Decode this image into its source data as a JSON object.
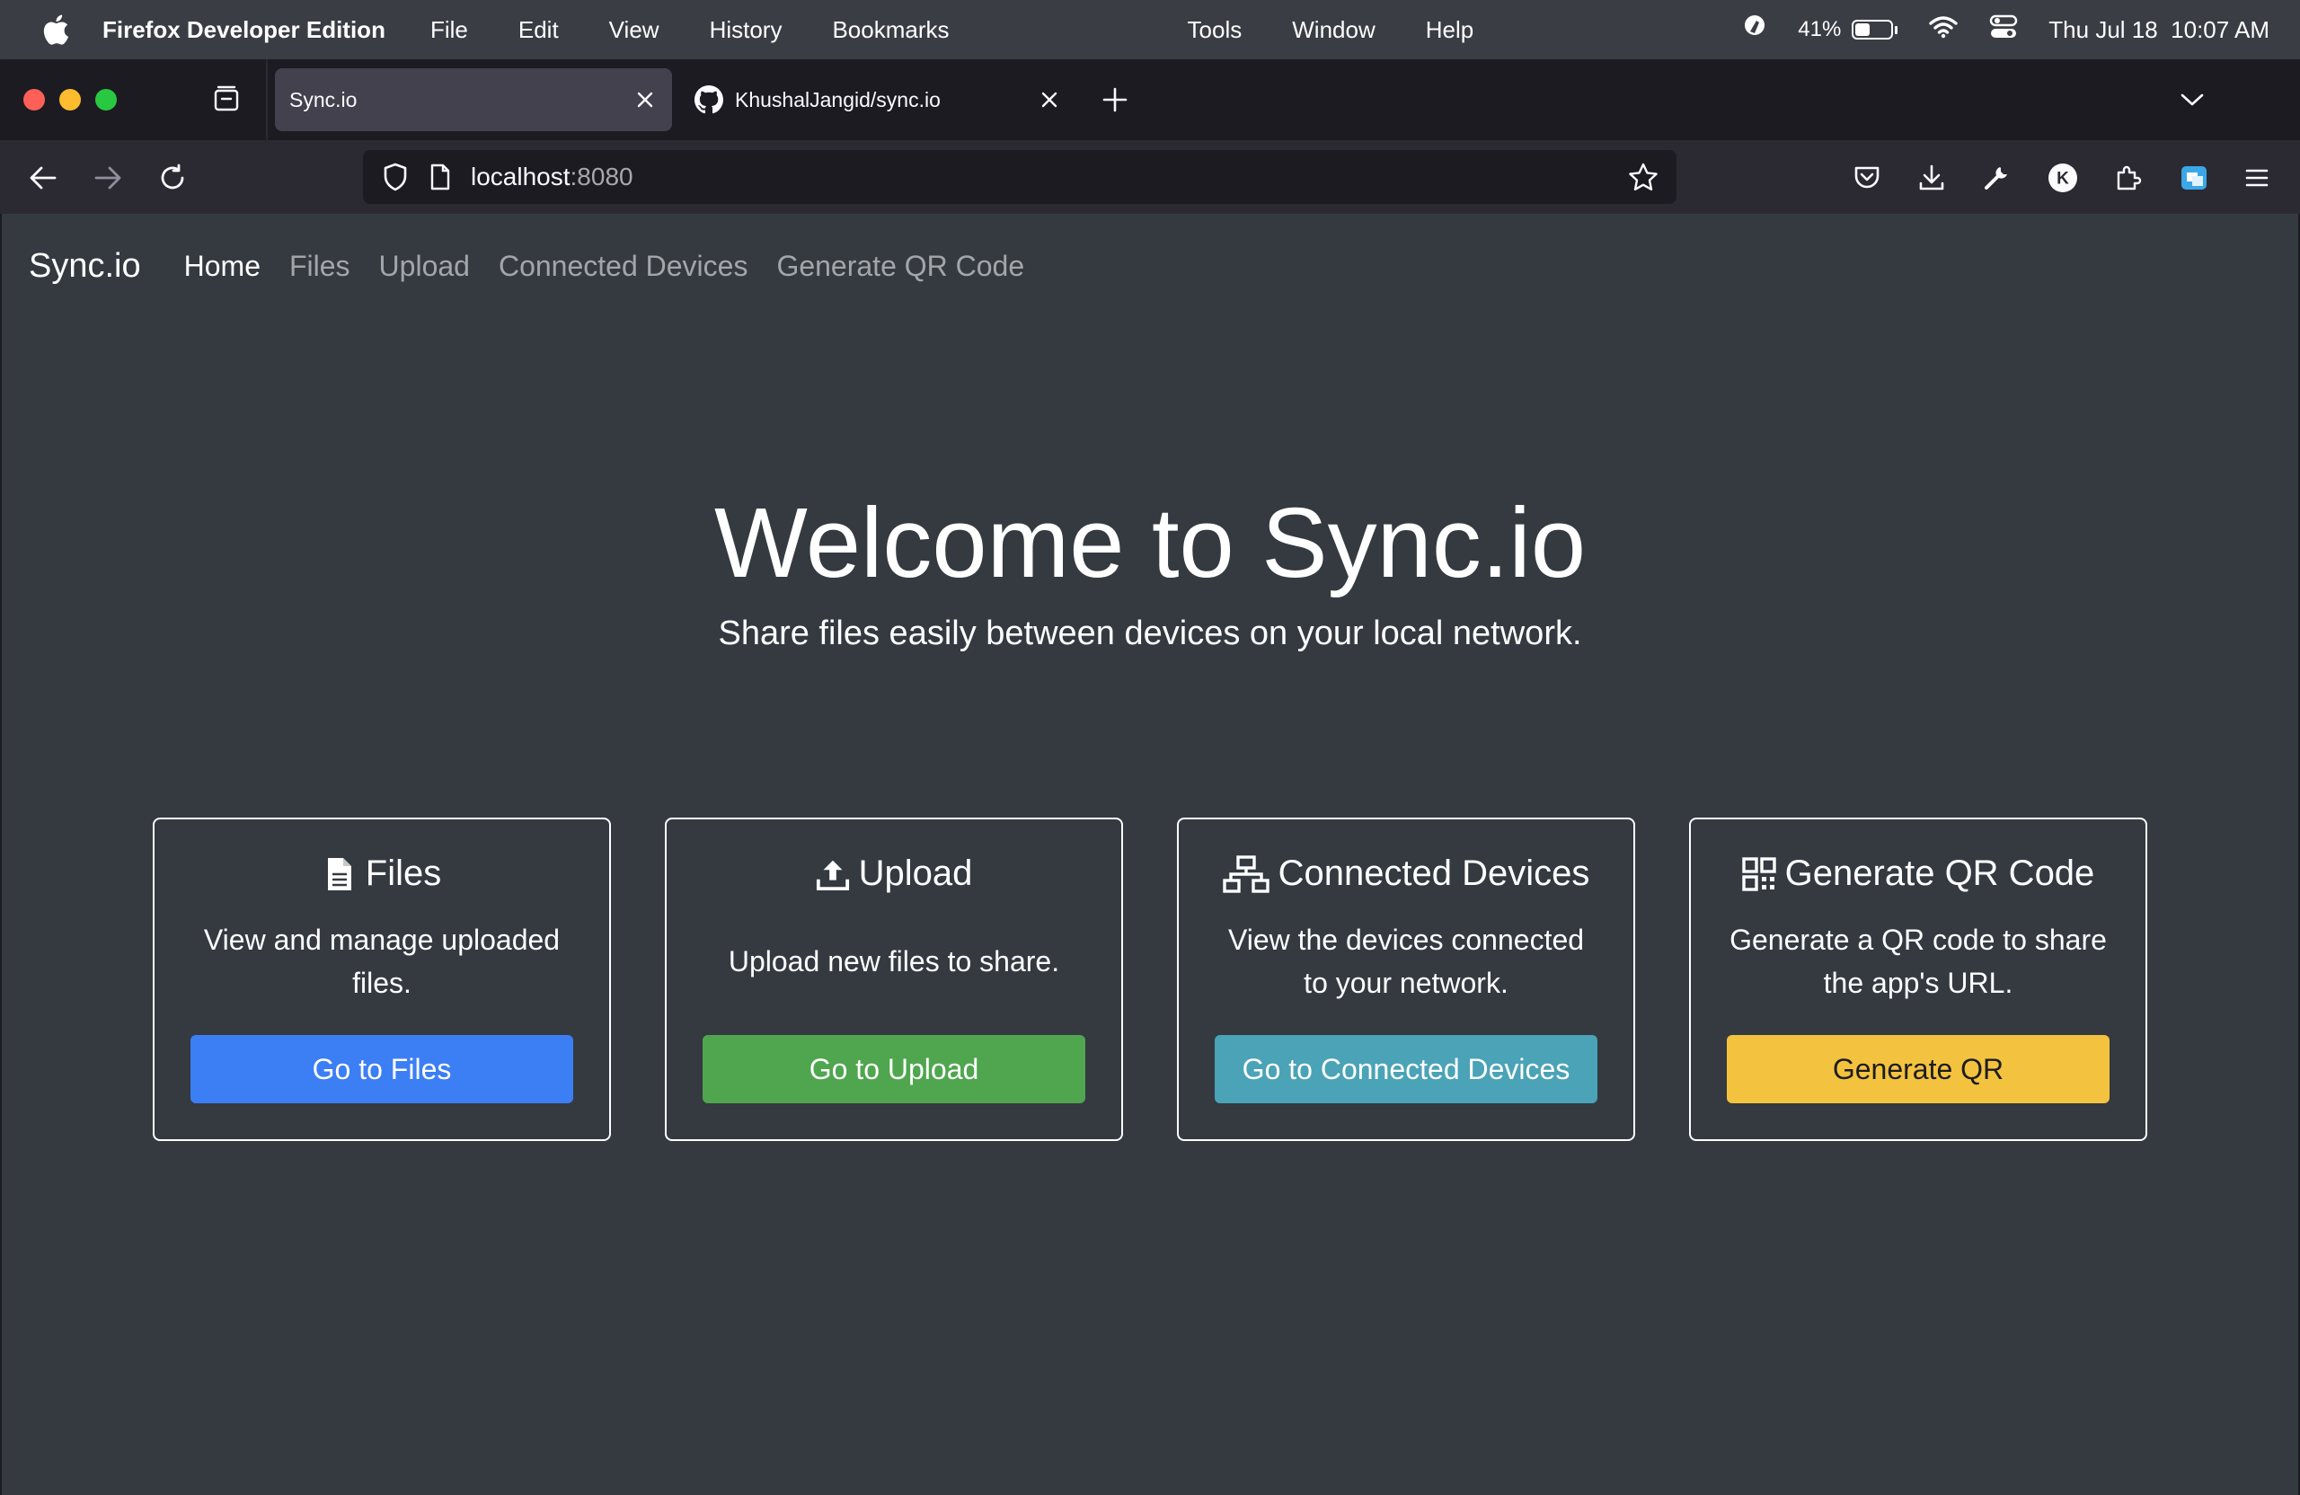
{
  "menubar": {
    "app_name": "Firefox Developer Edition",
    "items": [
      "File",
      "Edit",
      "View",
      "History",
      "Bookmarks",
      "Tools",
      "Window",
      "Help"
    ],
    "battery_percent": "41%",
    "battery_level": 0.41,
    "datetime": "Thu Jul 18  10:07 AM"
  },
  "browser": {
    "tabs": [
      {
        "label": "Sync.io",
        "active": true
      },
      {
        "label": "KhushalJangid/sync.io",
        "active": false,
        "icon": "github-icon"
      }
    ],
    "url_host": "localhost",
    "url_port": ":8080",
    "profile_initial": "K"
  },
  "site": {
    "brand": "Sync.io",
    "nav": [
      "Home",
      "Files",
      "Upload",
      "Connected Devices",
      "Generate QR Code"
    ],
    "active_nav": "Home",
    "hero_title": "Welcome to Sync.io",
    "hero_subtitle": "Share files easily between devices on your local network.",
    "cards": [
      {
        "icon": "file-icon",
        "title": "Files",
        "text": "View and manage uploaded files.",
        "button": "Go to Files",
        "color": "#3c7ef4"
      },
      {
        "icon": "upload-icon",
        "title": "Upload",
        "text": "Upload new files to share.",
        "button": "Go to Upload",
        "color": "#4fa64f"
      },
      {
        "icon": "network-icon",
        "title": "Connected Devices",
        "text": "View the devices connected to your network.",
        "button": "Go to Connected Devices",
        "color": "#4aa3b7"
      },
      {
        "icon": "qrcode-icon",
        "title": "Generate QR Code",
        "text": "Generate a QR code to share the app's URL.",
        "button": "Generate QR",
        "color": "#f3c23f"
      }
    ]
  }
}
